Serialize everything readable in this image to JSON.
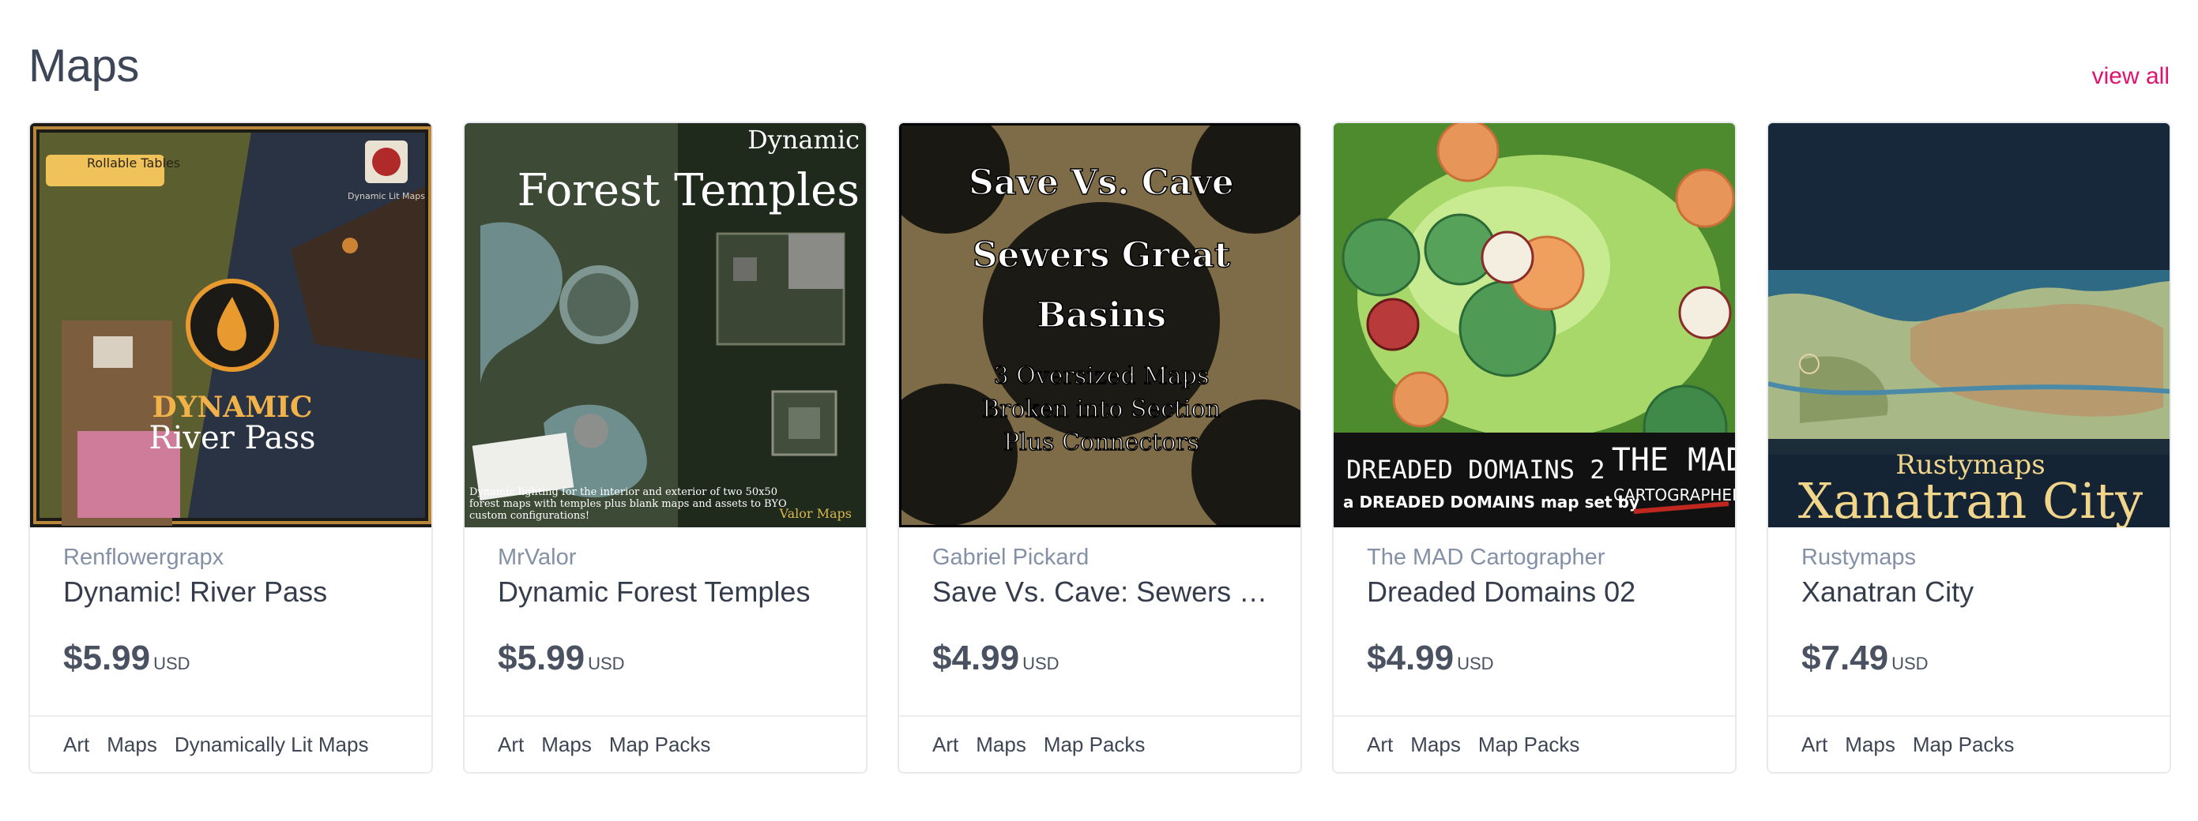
{
  "section": {
    "title": "Maps",
    "view_all": "view all"
  },
  "cards": [
    {
      "creator": "Renflowergrapx",
      "title": "Dynamic! River Pass",
      "price": "$5.99",
      "currency": "USD",
      "tags": [
        "Art",
        "Maps",
        "Dynamically Lit Maps"
      ],
      "thumb": {
        "badge": "Rollable Tables",
        "corner": "Dynamic Lit Maps",
        "line1": "DYNAMIC",
        "line2": "River Pass"
      }
    },
    {
      "creator": "MrValor",
      "title": "Dynamic Forest Temples",
      "price": "$5.99",
      "currency": "USD",
      "tags": [
        "Art",
        "Maps",
        "Map Packs"
      ],
      "thumb": {
        "line1": "Dynamic",
        "line2": "Forest Temples",
        "caption": "Dynamic lighting for the interior and exterior of two 50x50 forest maps with temples plus blank maps and assets to BYO custom configurations!",
        "logo": "Valor Maps"
      }
    },
    {
      "creator": "Gabriel Pickard",
      "title": "Save Vs. Cave: Sewers Great Basins",
      "price": "$4.99",
      "currency": "USD",
      "tags": [
        "Art",
        "Maps",
        "Map Packs"
      ],
      "thumb": {
        "line1": "Save Vs. Cave",
        "line2": "Sewers Great",
        "line3": "Basins",
        "line4": "3 Oversized Maps",
        "line5": "Broken into Section",
        "line6": "Plus Connectors"
      }
    },
    {
      "creator": "The MAD Cartographer",
      "title": "Dreaded Domains 02",
      "price": "$4.99",
      "currency": "USD",
      "tags": [
        "Art",
        "Maps",
        "Map Packs"
      ],
      "thumb": {
        "line1": "DREADED DOMAINS 2",
        "line2": "a DREADED DOMAINS map set by",
        "logo_top": "THE MAD",
        "logo_bottom": "CARTOGRAPHER"
      }
    },
    {
      "creator": "Rustymaps",
      "title": "Xanatran City",
      "price": "$7.49",
      "currency": "USD",
      "tags": [
        "Art",
        "Maps",
        "Map Packs"
      ],
      "thumb": {
        "line1": "Rustymaps",
        "line2": "Xanatran City"
      }
    }
  ],
  "colors": {
    "accent": "#e0126e",
    "creator": "#8390a6",
    "title": "#353d4c"
  }
}
